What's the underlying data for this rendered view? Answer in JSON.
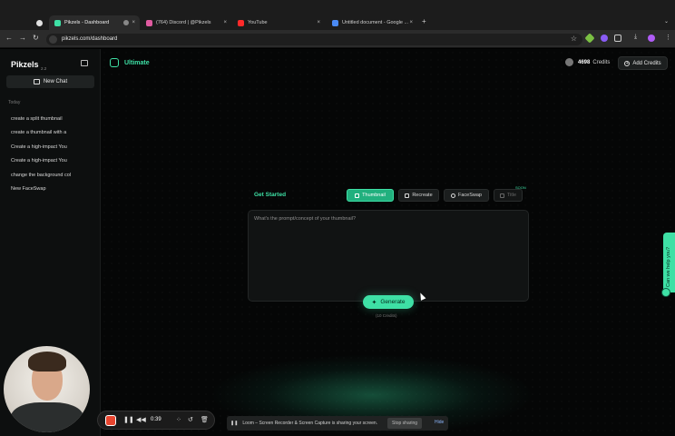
{
  "browser": {
    "tabs": [
      {
        "label": "",
        "favicon_color": "#e0e0e0"
      },
      {
        "label": "Pikzels - Dashboard",
        "favicon_color": "#3ee0a5"
      },
      {
        "label": "(764) Discord | @Pikzels",
        "favicon_color": "#e05ba0"
      },
      {
        "label": "YouTube",
        "favicon_color": "#ff2a2a"
      },
      {
        "label": "Untitled document - Google ...",
        "favicon_color": "#4a8af4"
      }
    ],
    "url": "pikzels.com/dashboard",
    "new_tab_glyph": "+",
    "close_glyph": "×"
  },
  "sidebar": {
    "logo": "Pikzels",
    "version": "2.2",
    "new_chat_label": "New Chat",
    "section": "Today",
    "history": [
      "create a split thumbnail",
      "create a thumbnail with a",
      "Create a high-impact You",
      "Create a high-impact You",
      "change the background col",
      "New FaceSwap"
    ]
  },
  "header": {
    "plan": "Ultimate",
    "credits_value": "4698",
    "credits_label": "Credits",
    "add_credits_label": "Add Credits"
  },
  "generator": {
    "get_started": "Get Started",
    "modes": [
      {
        "label": "Thumbnail",
        "icon": "image-icon",
        "state": "active"
      },
      {
        "label": "Recreate",
        "icon": "recreate-icon",
        "state": "normal"
      },
      {
        "label": "FaceSwap",
        "icon": "faceswap-icon",
        "state": "normal"
      },
      {
        "label": "Title",
        "icon": "title-icon",
        "state": "disabled"
      }
    ],
    "soon_badge": "SOON",
    "prompt_placeholder": "What's the prompt/concept of your thumbnail?",
    "generate_label": "Generate",
    "cost_label": "(10 Credits)"
  },
  "help": {
    "label": "Can we help you?"
  },
  "loom": {
    "timer": "0:39",
    "share_text": "Loom – Screen Recorder & Screen Capture is sharing your screen.",
    "stop_label": "Stop sharing",
    "hide_label": "Hide"
  },
  "colors": {
    "accent": "#3ee0a5",
    "background": "#050606",
    "record": "#e8452f"
  }
}
